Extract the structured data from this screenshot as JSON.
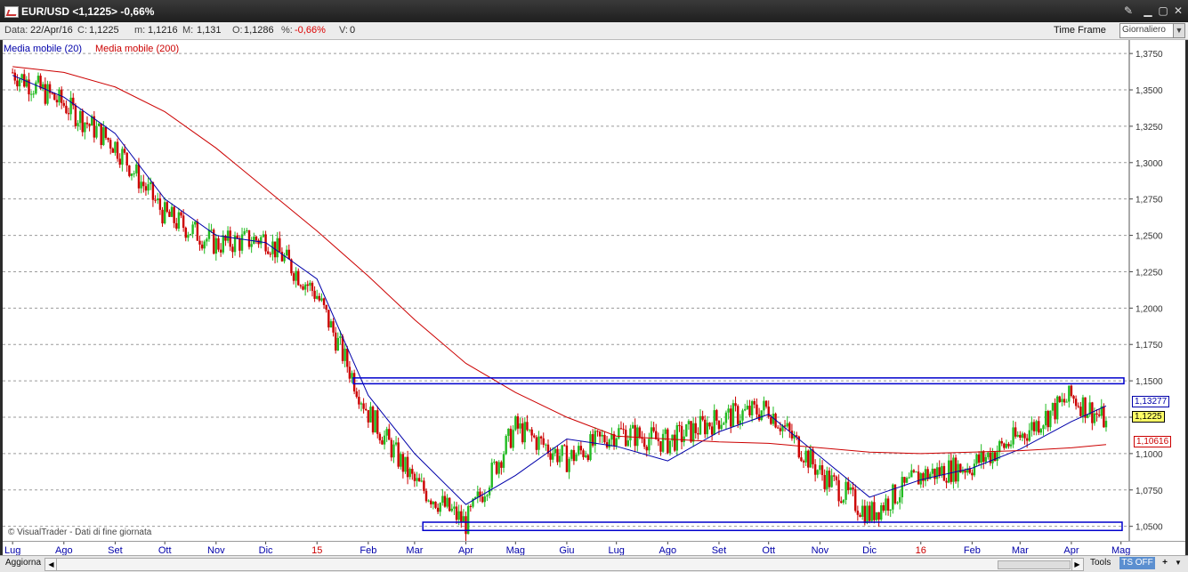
{
  "window": {
    "title": "EUR/USD <1,1225> -0,66%",
    "pin_icon": "pin-icon",
    "minimize_icon": "minimize-icon",
    "maximize_icon": "maximize-icon",
    "close_icon": "close-icon"
  },
  "info": {
    "date_label": "Data:",
    "date_value": "22/Apr/16",
    "close_label": "C:",
    "close_value": "1,1225",
    "min_label": "m:",
    "min_value": "1,1216",
    "max_label": "M:",
    "max_value": "1,131",
    "open_label": "O:",
    "open_value": "1,1286",
    "pct_label": "%:",
    "pct_value": "-0,66%",
    "vol_label": "V:",
    "vol_value": "0",
    "timeframe_label": "Time Frame",
    "timeframe_value": "Giornaliero"
  },
  "legend": {
    "ma20": "Media mobile (20)",
    "ma200": "Media mobile (200)"
  },
  "footer_note": "© VisualTrader - Dati di fine giornata",
  "bottom": {
    "update_button": "Aggiorna",
    "tools_button": "Tools",
    "ts_button": "TS OFF",
    "plus_icon": "plus-icon",
    "dropdown_icon": "chevron-down-icon"
  },
  "price_labels": {
    "ma20": "1,13277",
    "last": "1,1225",
    "ma200": "1,10616"
  },
  "colors": {
    "ma20": "#0000aa",
    "ma200": "#cc0000",
    "bull": "#22bb22",
    "bear": "#cc0000",
    "rect": "#0000cc",
    "last_bg": "#ffff66"
  },
  "chart_data": {
    "type": "line",
    "title": "EUR/USD",
    "xlabel": "",
    "ylabel": "",
    "ylim": [
      1.04,
      1.3812
    ],
    "y_ticks": [
      "1,3750",
      "1,3500",
      "1,3250",
      "1,3000",
      "1,2750",
      "1,2500",
      "1,2250",
      "1,2000",
      "1,1750",
      "1,1500",
      "1,1250",
      "1,1000",
      "1,0750",
      "1,0500"
    ],
    "x_ticks": [
      "Lug",
      "Ago",
      "Set",
      "Ott",
      "Nov",
      "Dic",
      "15",
      "Feb",
      "Mar",
      "Apr",
      "Mag",
      "Giu",
      "Lug",
      "Ago",
      "Set",
      "Ott",
      "Nov",
      "Dic",
      "16",
      "Feb",
      "Mar",
      "Apr",
      "Mag"
    ],
    "x_tick_colors": [
      "#0000aa",
      "#0000aa",
      "#0000aa",
      "#0000aa",
      "#0000aa",
      "#0000aa",
      "#cc0000",
      "#0000aa",
      "#0000aa",
      "#0000aa",
      "#0000aa",
      "#0000aa",
      "#0000aa",
      "#0000aa",
      "#0000aa",
      "#0000aa",
      "#0000aa",
      "#0000aa",
      "#cc0000",
      "#0000aa",
      "#0000aa",
      "#0000aa",
      "#0000aa"
    ],
    "x": [
      "2014-07-01",
      "2014-08-01",
      "2014-09-01",
      "2014-10-01",
      "2014-11-01",
      "2014-12-01",
      "2015-01-01",
      "2015-02-01",
      "2015-03-01",
      "2015-04-01",
      "2015-05-01",
      "2015-06-01",
      "2015-07-01",
      "2015-08-01",
      "2015-09-01",
      "2015-10-01",
      "2015-11-01",
      "2015-12-01",
      "2016-01-01",
      "2016-02-01",
      "2016-03-01",
      "2016-04-01",
      "2016-04-22"
    ],
    "series": [
      {
        "name": "EUR/USD",
        "values": [
          1.362,
          1.34,
          1.312,
          1.264,
          1.244,
          1.248,
          1.209,
          1.128,
          1.08,
          1.052,
          1.118,
          1.096,
          1.115,
          1.108,
          1.124,
          1.131,
          1.087,
          1.058,
          1.085,
          1.092,
          1.112,
          1.139,
          1.1225
        ]
      },
      {
        "name": "Media mobile (20)",
        "values": [
          1.36,
          1.345,
          1.32,
          1.275,
          1.25,
          1.245,
          1.22,
          1.14,
          1.1,
          1.065,
          1.085,
          1.11,
          1.105,
          1.095,
          1.115,
          1.127,
          1.098,
          1.07,
          1.082,
          1.09,
          1.103,
          1.122,
          1.13277
        ]
      },
      {
        "name": "Media mobile (200)",
        "values": [
          1.366,
          1.362,
          1.352,
          1.335,
          1.31,
          1.282,
          1.253,
          1.222,
          1.192,
          1.162,
          1.142,
          1.125,
          1.112,
          1.11,
          1.108,
          1.107,
          1.104,
          1.101,
          1.1,
          1.101,
          1.102,
          1.104,
          1.10616
        ]
      }
    ],
    "support_zone": [
      1.049,
      1.051
    ],
    "resistance_zone": [
      1.148,
      1.152
    ]
  }
}
